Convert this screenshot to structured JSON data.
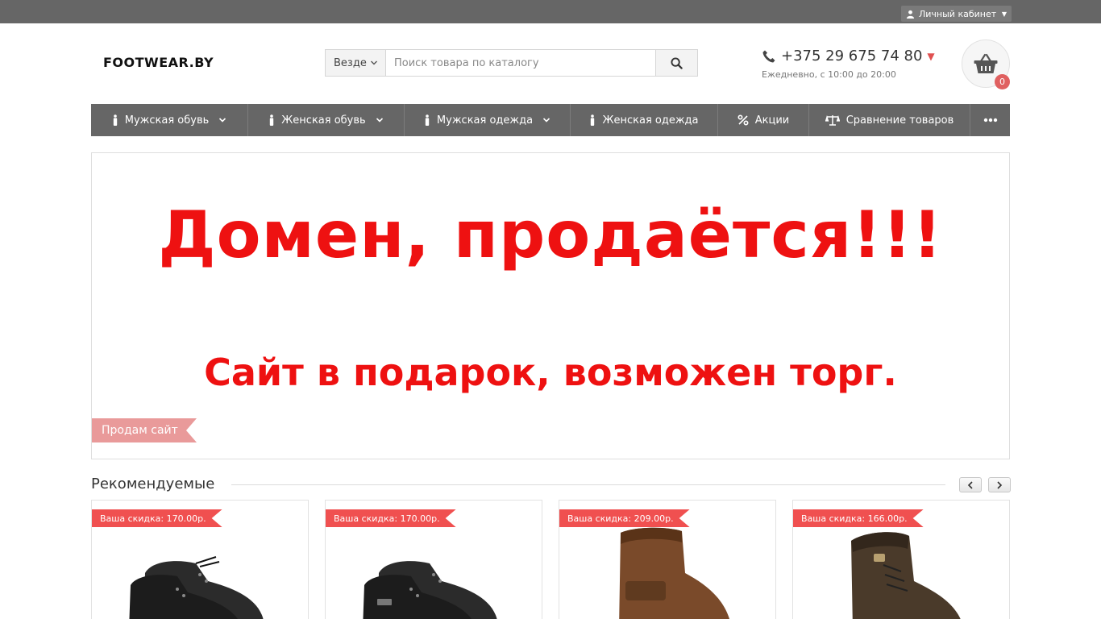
{
  "header": {
    "account_label": "Личный кабинет",
    "logo": "FOOTWEAR.BY",
    "search": {
      "scope": "Везде",
      "placeholder": "Поиск товара по каталогу"
    },
    "phone": "+375 29 675 74 80",
    "hours": "Ежедневно, с 10:00 до 20:00",
    "cart_count": "0"
  },
  "nav": {
    "items": [
      {
        "label": "Мужская обувь",
        "icon": "person-icon"
      },
      {
        "label": "Женская обувь",
        "icon": "person-icon"
      },
      {
        "label": "Мужская одежда",
        "icon": "person-icon"
      },
      {
        "label": "Женская одежда",
        "icon": "person-icon"
      },
      {
        "label": "Акции",
        "icon": "percent-icon"
      },
      {
        "label": "Сравнение товаров",
        "icon": "scales-icon"
      }
    ]
  },
  "banner": {
    "line1": "Домен, продаётся!!!",
    "line2": "Сайт в подарок, возможен торг.",
    "tag": "Продам сайт"
  },
  "recommended": {
    "title": "Рекомендуемые",
    "products": [
      {
        "discount": "Ваша скидка: 170.00р."
      },
      {
        "discount": "Ваша скидка: 170.00р."
      },
      {
        "discount": "Ваша скидка: 209.00р."
      },
      {
        "discount": "Ваша скидка: 166.00р."
      }
    ]
  },
  "colors": {
    "bar": "#666666",
    "accent": "#f05050",
    "banner_text": "#ee1111"
  }
}
